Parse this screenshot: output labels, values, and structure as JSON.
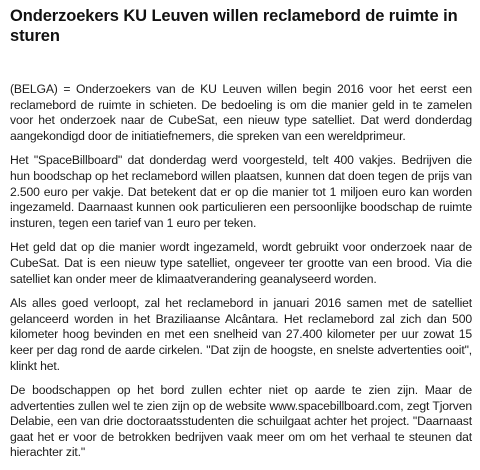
{
  "article": {
    "headline": "Onderzoekers KU Leuven willen reclamebord de ruimte in sturen",
    "paragraphs": [
      "(BELGA) = Onderzoekers van de KU Leuven willen begin 2016 voor het eerst een reclamebord de ruimte in schieten. De bedoeling is om die manier geld in te zamelen voor het onderzoek naar de CubeSat, een nieuw type satelliet. Dat werd donderdag aangekondigd door de initiatiefnemers, die spreken van een wereldprimeur.",
      "Het \"SpaceBillboard\" dat donderdag werd voorgesteld, telt 400 vakjes. Bedrijven die hun boodschap op het reclamebord willen plaatsen, kunnen dat doen tegen de prijs van 2.500 euro per vakje. Dat betekent dat er op die manier tot 1 miljoen euro kan worden ingezameld. Daarnaast kunnen ook particulieren een persoonlijke boodschap de ruimte insturen, tegen een tarief van 1 euro per teken.",
      "Het geld dat op die manier wordt ingezameld, wordt gebruikt voor onderzoek naar de CubeSat. Dat is een nieuw type satelliet, ongeveer ter grootte van een brood. Via die satelliet kan onder meer de klimaatverandering geanalyseerd worden.",
      "Als alles goed verloopt, zal het reclamebord in januari 2016 samen met de satelliet gelanceerd worden in het Braziliaanse Alcântara. Het reclamebord zal zich dan 500 kilometer hoog bevinden en met een snelheid van 27.400 kilometer per uur zowat 15 keer per dag rond de aarde cirkelen. \"Dat zijn de hoogste, en snelste advertenties ooit\", klinkt het.",
      "De boodschappen op het bord zullen echter niet op aarde te zien zijn. Maar de advertenties zullen wel te zien zijn op de website www.spacebillboard.com, zegt Tjorven Delabie, een van drie doctoraatsstudenten die schuilgaat achter het project. \"Daarnaast gaat het er voor de betrokken bedrijven vaak meer om om het verhaal te steunen dat hierachter zit.\""
    ]
  }
}
